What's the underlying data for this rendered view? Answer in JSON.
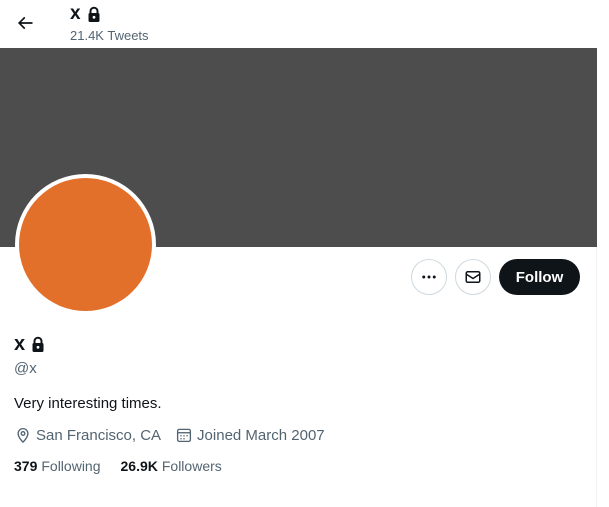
{
  "header": {
    "name": "x",
    "tweet_count": "21.4K Tweets",
    "back_icon": "arrow-left-icon",
    "lock_icon": "lock-icon"
  },
  "colors": {
    "banner": "#4d4d4d",
    "avatar": "#e2702a",
    "follow_button_bg": "#0f1419",
    "secondary_text": "#536471"
  },
  "actions": {
    "more_icon": "more-horizontal-icon",
    "message_icon": "envelope-icon",
    "follow_label": "Follow"
  },
  "profile": {
    "name": "x",
    "handle": "@x",
    "bio": "Very interesting times.",
    "location": "San Francisco, CA",
    "joined": "Joined March 2007",
    "location_icon": "map-pin-icon",
    "joined_icon": "calendar-icon"
  },
  "stats": {
    "following_count": "379",
    "following_label": "Following",
    "followers_count": "26.9K",
    "followers_label": "Followers"
  }
}
